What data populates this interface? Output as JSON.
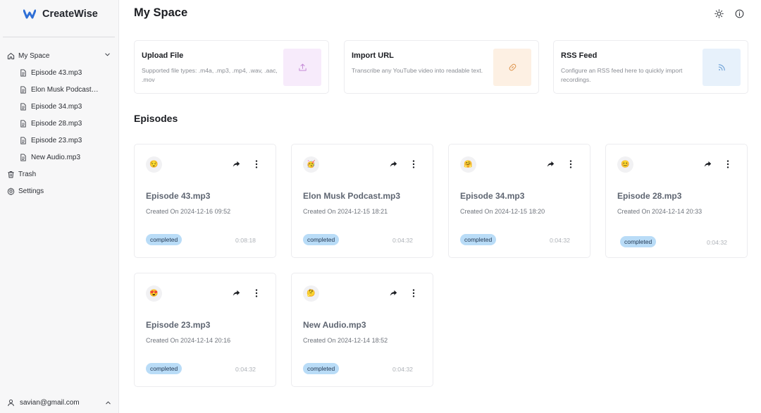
{
  "app": {
    "name": "CreateWise"
  },
  "sidebar": {
    "my_space": {
      "label": "My Space",
      "icon": "home-icon"
    },
    "files": [
      {
        "label": "Episode 43.mp3"
      },
      {
        "label": "Elon Musk Podcast.mp3"
      },
      {
        "label": "Episode 34.mp3"
      },
      {
        "label": "Episode 28.mp3"
      },
      {
        "label": "Episode 23.mp3"
      },
      {
        "label": "New Audio.mp3"
      }
    ],
    "trash": {
      "label": "Trash",
      "icon": "trash-icon"
    },
    "settings": {
      "label": "Settings",
      "icon": "gear-icon"
    },
    "user": {
      "email": "savian@gmail.com"
    }
  },
  "main": {
    "title": "My Space",
    "import_options": [
      {
        "title": "Upload File",
        "description": "Supported file types: .m4a, .mp3, .mp4, .wav, .aac, .mov",
        "icon": "upload-icon",
        "tile_color": "#f7ebfb",
        "icon_color": "#c58ad6"
      },
      {
        "title": "Import URL",
        "description": "Transcribe any YouTube video into readable text.",
        "icon": "link-icon",
        "tile_color": "#fdf0e3",
        "icon_color": "#e09a55"
      },
      {
        "title": "RSS Feed",
        "description": "Configure an RSS feed here to quickly import recordings.",
        "icon": "rss-icon",
        "tile_color": "#e7f1fb",
        "icon_color": "#6a9fd6"
      }
    ],
    "episodes_title": "Episodes",
    "episodes": [
      {
        "emoji": "😌",
        "title": "Episode 43.mp3",
        "created": "Created On 2024-12-16 09:52",
        "status": "completed",
        "duration": "0:08:18"
      },
      {
        "emoji": "🥳",
        "title": "Elon Musk Podcast.mp3",
        "created": "Created On 2024-12-15 18:21",
        "status": "completed",
        "duration": "0:04:32"
      },
      {
        "emoji": "🤗",
        "title": "Episode 34.mp3",
        "created": "Created On 2024-12-15 18:20",
        "status": "completed",
        "duration": "0:04:32"
      },
      {
        "emoji": "😊",
        "title": "Episode 28.mp3",
        "created": "Created On 2024-12-14 20:33",
        "status": "completed",
        "duration": "0:04:32"
      },
      {
        "emoji": "😍",
        "title": "Episode 23.mp3",
        "created": "Created On 2024-12-14 20:16",
        "status": "completed",
        "duration": "0:04:32"
      },
      {
        "emoji": "🤔",
        "title": "New Audio.mp3",
        "created": "Created On 2024-12-14 18:52",
        "status": "completed",
        "duration": "0:04:32"
      }
    ]
  },
  "colors": {
    "accent": "#2f6fd6",
    "badge_bg": "#b9dcf7",
    "sidebar_bg": "#f7f7f8"
  }
}
